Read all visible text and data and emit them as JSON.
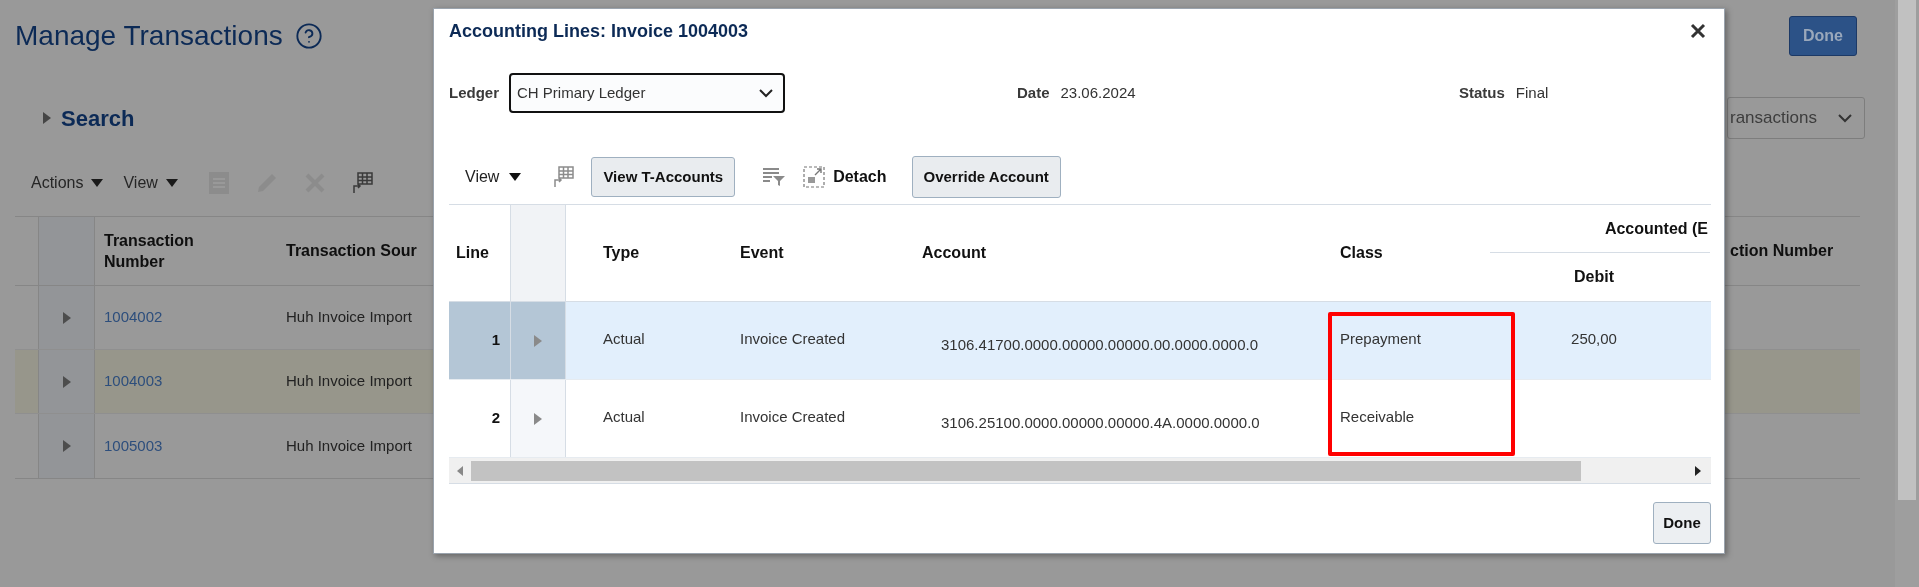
{
  "page": {
    "title": "Manage Transactions",
    "search_label": "Search",
    "done_button": "Done",
    "view_select": "ransactions",
    "menus": [
      {
        "label": "Actions"
      },
      {
        "label": "View"
      }
    ],
    "table": {
      "columns": [
        "Transaction Number",
        "Transaction Sour",
        "ction Number"
      ],
      "rows": [
        {
          "number": "1004002",
          "source": "Huh Invoice Import",
          "selected": false
        },
        {
          "number": "1004003",
          "source": "Huh Invoice Import",
          "selected": true
        },
        {
          "number": "1005003",
          "source": "Huh Invoice Import",
          "selected": false
        }
      ]
    }
  },
  "dialog": {
    "title": "Accounting Lines: Invoice 1004003",
    "ledger": {
      "label": "Ledger",
      "value": "CH Primary Ledger"
    },
    "date": {
      "label": "Date",
      "value": "23.06.2024"
    },
    "status": {
      "label": "Status",
      "value": "Final"
    },
    "toolbar": {
      "view_menu": "View",
      "t_accounts_button": "View T-Accounts",
      "detach": "Detach",
      "override_button": "Override Account"
    },
    "table": {
      "columns": {
        "line": "Line",
        "type": "Type",
        "event": "Event",
        "account": "Account",
        "class": "Class",
        "group": "Accounted (E",
        "debit": "Debit"
      },
      "rows": [
        {
          "line": "1",
          "type": "Actual",
          "event": "Invoice Created",
          "account": "3106.41700.0000.00000.00000.00.0000.0000.0",
          "class": "Prepayment",
          "debit": "250,00",
          "selected": true
        },
        {
          "line": "2",
          "type": "Actual",
          "event": "Invoice Created",
          "account": "3106.25100.0000.00000.00000.4A.0000.0000.0",
          "class": "Receivable",
          "selected": false
        }
      ],
      "annotation": {
        "kind": "box"
      }
    },
    "done_button": "Done"
  }
}
